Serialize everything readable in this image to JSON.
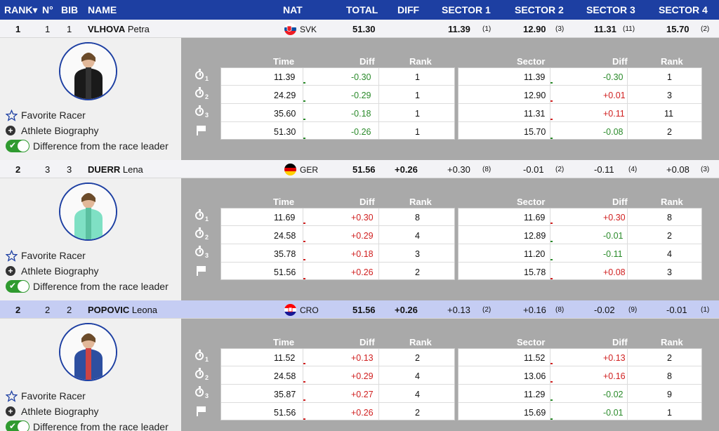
{
  "header": {
    "rank": "RANK▾",
    "no": "N°",
    "bib": "BIB",
    "name": "NAME",
    "nat": "NAT",
    "total": "TOTAL",
    "diff": "DIFF",
    "sector1": "SECTOR 1",
    "sector2": "SECTOR 2",
    "sector3": "SECTOR 3",
    "sector4": "SECTOR 4"
  },
  "detail_headers": {
    "time": "Time",
    "diff": "Diff",
    "rank": "Rank",
    "sector": "Sector",
    "sdiff": "Diff",
    "srank": "Rank"
  },
  "links": {
    "favorite": "Favorite Racer",
    "biography": "Athlete Biography",
    "difference": "Difference from the race leader"
  },
  "athletes": [
    {
      "rank": "1",
      "no": "1",
      "bib": "1",
      "surname": "VLHOVA",
      "firstname": "Petra",
      "nat": "SVK",
      "total": "51.30",
      "diff": "",
      "s1": "11.39",
      "s1r": "(1)",
      "s2": "12.90",
      "s2r": "(3)",
      "s3": "11.31",
      "s3r": "(11)",
      "s4": "15.70",
      "s4r": "(2)",
      "rows": [
        {
          "time": "11.39",
          "diff": "-0.30",
          "rank": "1",
          "sector": "11.39",
          "sdiff": "-0.30",
          "srank": "1"
        },
        {
          "time": "24.29",
          "diff": "-0.29",
          "rank": "1",
          "sector": "12.90",
          "sdiff": "+0.01",
          "srank": "3"
        },
        {
          "time": "35.60",
          "diff": "-0.18",
          "rank": "1",
          "sector": "11.31",
          "sdiff": "+0.11",
          "srank": "11"
        },
        {
          "time": "51.30",
          "diff": "-0.26",
          "rank": "1",
          "sector": "15.70",
          "sdiff": "-0.08",
          "srank": "2"
        }
      ]
    },
    {
      "rank": "2",
      "no": "3",
      "bib": "3",
      "surname": "DUERR",
      "firstname": "Lena",
      "nat": "GER",
      "total": "51.56",
      "diff": "+0.26",
      "s1": "+0.30",
      "s1r": "(8)",
      "s2": "-0.01",
      "s2r": "(2)",
      "s3": "-0.11",
      "s3r": "(4)",
      "s4": "+0.08",
      "s4r": "(3)",
      "rows": [
        {
          "time": "11.69",
          "diff": "+0.30",
          "rank": "8",
          "sector": "11.69",
          "sdiff": "+0.30",
          "srank": "8"
        },
        {
          "time": "24.58",
          "diff": "+0.29",
          "rank": "4",
          "sector": "12.89",
          "sdiff": "-0.01",
          "srank": "2"
        },
        {
          "time": "35.78",
          "diff": "+0.18",
          "rank": "3",
          "sector": "11.20",
          "sdiff": "-0.11",
          "srank": "4"
        },
        {
          "time": "51.56",
          "diff": "+0.26",
          "rank": "2",
          "sector": "15.78",
          "sdiff": "+0.08",
          "srank": "3"
        }
      ]
    },
    {
      "rank": "2",
      "no": "2",
      "bib": "2",
      "surname": "POPOVIC",
      "firstname": "Leona",
      "nat": "CRO",
      "total": "51.56",
      "diff": "+0.26",
      "s1": "+0.13",
      "s1r": "(2)",
      "s2": "+0.16",
      "s2r": "(8)",
      "s3": "-0.02",
      "s3r": "(9)",
      "s4": "-0.01",
      "s4r": "(1)",
      "rows": [
        {
          "time": "11.52",
          "diff": "+0.13",
          "rank": "2",
          "sector": "11.52",
          "sdiff": "+0.13",
          "srank": "2"
        },
        {
          "time": "24.58",
          "diff": "+0.29",
          "rank": "4",
          "sector": "13.06",
          "sdiff": "+0.16",
          "srank": "8"
        },
        {
          "time": "35.87",
          "diff": "+0.27",
          "rank": "4",
          "sector": "11.29",
          "sdiff": "-0.02",
          "srank": "9"
        },
        {
          "time": "51.56",
          "diff": "+0.26",
          "rank": "2",
          "sector": "15.69",
          "sdiff": "-0.01",
          "srank": "1"
        }
      ]
    }
  ],
  "icons": {
    "split1": "stopwatch-icon",
    "split2": "stopwatch-icon",
    "split3": "stopwatch-icon",
    "finish": "flag-icon",
    "favorite": "star-icon",
    "bio": "plus-circle-icon",
    "toggle": "toggle-icon"
  },
  "split_numbers": [
    "1",
    "2",
    "3"
  ],
  "colors": {
    "header_bg": "#1d3fa2",
    "highlight": "#c5cdf3",
    "panel": "#a9a9a9",
    "positive": "#d02020",
    "negative": "#2a8a2a",
    "toggle": "#2f9a2f"
  }
}
